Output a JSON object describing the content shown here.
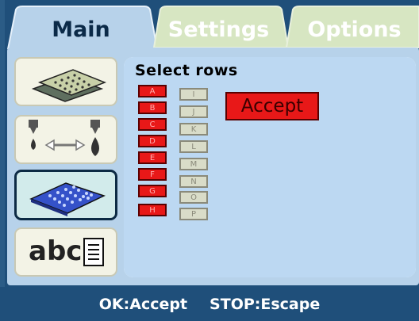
{
  "tabs": [
    {
      "label": "Main",
      "active": true
    },
    {
      "label": "Settings",
      "active": false
    },
    {
      "label": "Options",
      "active": false
    }
  ],
  "side_buttons": [
    {
      "name": "tray-stack-icon"
    },
    {
      "name": "dispense-transfer-icon"
    },
    {
      "name": "plate-rows-icon",
      "active": true
    },
    {
      "name": "abc-text-icon",
      "text": "abc"
    }
  ],
  "main": {
    "title": "Select rows",
    "rows_left": [
      "A",
      "B",
      "C",
      "D",
      "E",
      "F",
      "G",
      "H"
    ],
    "rows_right": [
      "I",
      "J",
      "K",
      "L",
      "M",
      "N",
      "O",
      "P"
    ],
    "accept_label": "Accept"
  },
  "footer": {
    "ok_hint": "OK:Accept",
    "stop_hint": "STOP:Escape"
  },
  "colors": {
    "frame": "#1f4f7a",
    "panel": "#b7d2ea",
    "selected_row": "#e81818",
    "unselected_row": "#d9dcc8",
    "active_tab": "#b7d2ea",
    "inactive_tab": "#d7e6c2"
  }
}
